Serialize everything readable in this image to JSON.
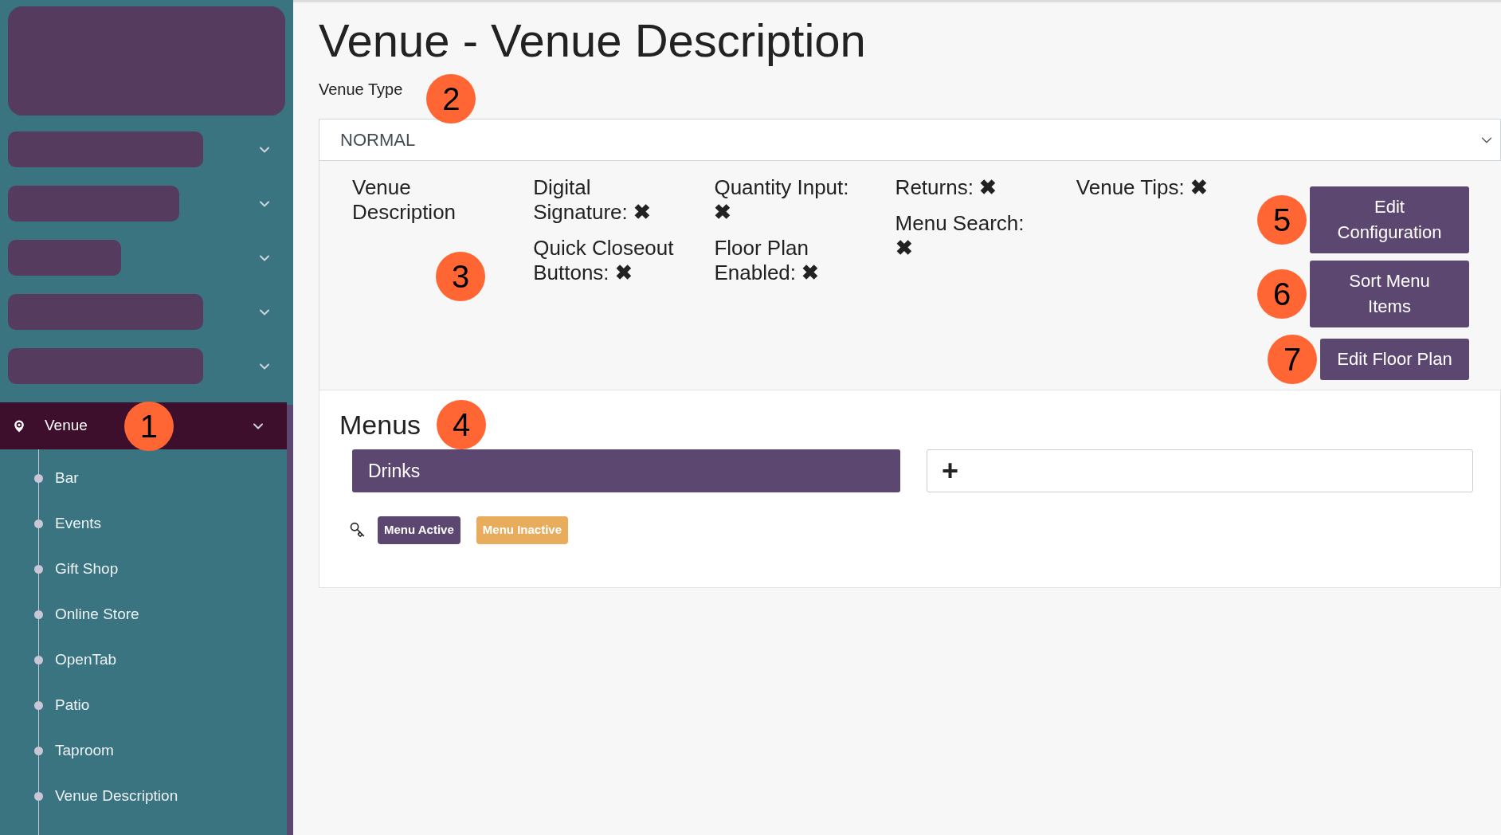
{
  "sidebar": {
    "groups": [
      {
        "kind": "logo"
      },
      {
        "kind": "redacted"
      },
      {
        "kind": "redacted"
      },
      {
        "kind": "redacted"
      },
      {
        "kind": "redacted"
      },
      {
        "kind": "redacted"
      },
      {
        "kind": "item",
        "label": "Venue",
        "expanded": true,
        "selected": true,
        "children": [
          {
            "label": "Bar",
            "selected": false
          },
          {
            "label": "Events",
            "selected": false
          },
          {
            "label": "Gift Shop",
            "selected": false
          },
          {
            "label": "Online Store",
            "selected": false
          },
          {
            "label": "OpenTab",
            "selected": false
          },
          {
            "label": "Patio",
            "selected": false
          },
          {
            "label": "Taproom",
            "selected": false
          },
          {
            "label": "Venue Description",
            "selected": false
          }
        ]
      }
    ]
  },
  "page": {
    "title": "Venue - Venue Description"
  },
  "venue_type": {
    "label": "Venue Type",
    "value": "NORMAL"
  },
  "settings": {
    "columns": [
      [
        {
          "label": "Venue Description"
        }
      ],
      [
        {
          "label": "Digital Signature:",
          "mark": "✖"
        },
        {
          "label": "Quick Closeout Buttons:",
          "mark": "✖"
        }
      ],
      [
        {
          "label": "Quantity Input:",
          "mark": "✖"
        },
        {
          "label": "Floor Plan Enabled:",
          "mark": "✖"
        }
      ],
      [
        {
          "label": "Returns:",
          "mark": "✖"
        },
        {
          "label": "Menu Search:",
          "mark": "✖"
        }
      ],
      [
        {
          "label": "Venue Tips:",
          "mark": "✖"
        }
      ]
    ],
    "buttons": [
      "Edit Configuration",
      "Sort Menu Items",
      "Edit Floor Plan"
    ]
  },
  "menus": {
    "title": "Menus",
    "items": [
      {
        "label": "Drinks"
      }
    ],
    "add_symbol": "+",
    "legend": [
      {
        "label": "Menu Active",
        "color": "#5c4770"
      },
      {
        "label": "Menu Inactive",
        "color": "#e8ad5c"
      }
    ]
  },
  "callouts": [
    "1",
    "2",
    "3",
    "4",
    "5",
    "6",
    "7"
  ]
}
